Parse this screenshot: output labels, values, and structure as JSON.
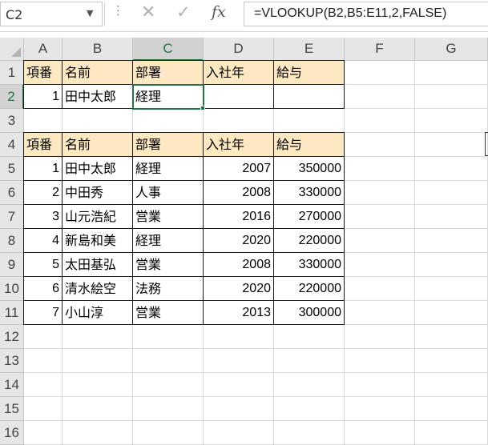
{
  "namebox": {
    "value": "C2"
  },
  "formula_bar": {
    "formula": "=VLOOKUP(B2,B5:E11,2,FALSE)",
    "fx_label": "fx"
  },
  "icons": {
    "cancel": "✕",
    "enter": "✓",
    "dots": "⋮",
    "dropdown": "▼"
  },
  "columns": [
    "A",
    "B",
    "C",
    "D",
    "E",
    "F",
    "G"
  ],
  "rows": [
    "1",
    "2",
    "3",
    "4",
    "5",
    "6",
    "7",
    "8",
    "9",
    "10",
    "11",
    "12",
    "13",
    "14",
    "15",
    "16"
  ],
  "selected": {
    "column": "C",
    "row": "2"
  },
  "lookup_table": {
    "headers": [
      "項番",
      "名前",
      "部署",
      "入社年",
      "給与"
    ],
    "row": [
      "1",
      "田中太郎",
      "経理",
      "",
      ""
    ]
  },
  "data_table": {
    "headers": [
      "項番",
      "名前",
      "部署",
      "入社年",
      "給与"
    ],
    "rows": [
      [
        "1",
        "田中太郎",
        "経理",
        "2007",
        "350000"
      ],
      [
        "2",
        "中田秀",
        "人事",
        "2008",
        "330000"
      ],
      [
        "3",
        "山元浩紀",
        "営業",
        "2016",
        "270000"
      ],
      [
        "4",
        "新島和美",
        "経理",
        "2020",
        "220000"
      ],
      [
        "5",
        "太田基弘",
        "営業",
        "2008",
        "330000"
      ],
      [
        "6",
        "清水絵空",
        "法務",
        "2020",
        "220000"
      ],
      [
        "7",
        "小山淳",
        "営業",
        "2013",
        "300000"
      ]
    ]
  },
  "colors": {
    "accent": "#217346",
    "header_fill": "#fde9c1"
  }
}
